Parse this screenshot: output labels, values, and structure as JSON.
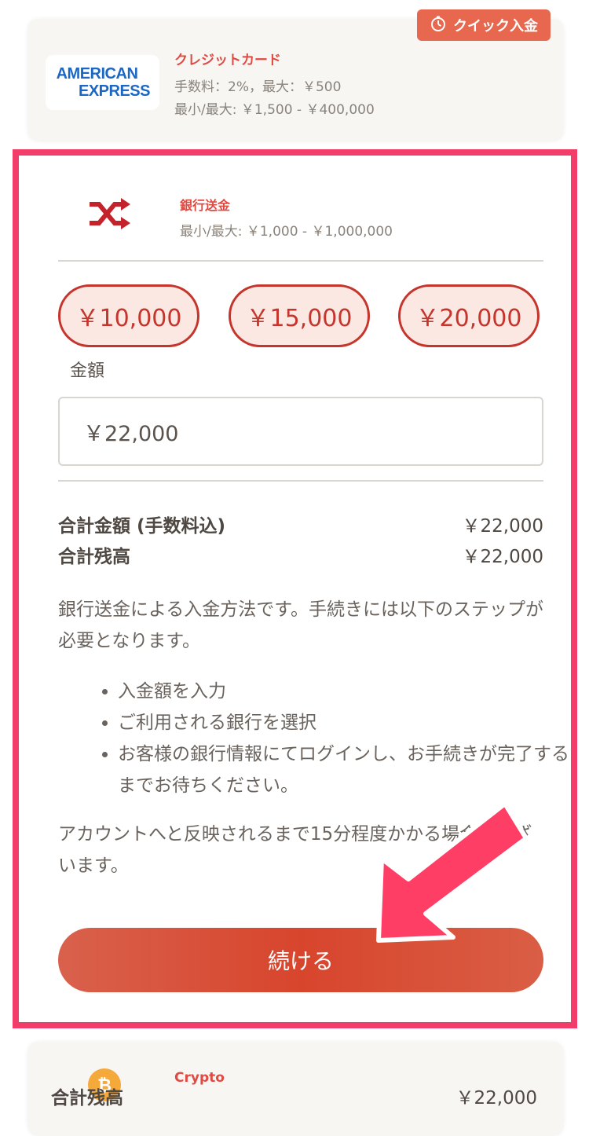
{
  "credit_card": {
    "quick_badge": "クイック入金",
    "logo_line1": "AMERICAN",
    "logo_line2": "EXPRESS",
    "title": "クレジットカード",
    "fee": "手数料：2%，最大：￥500",
    "range": "最小/最大: ￥1,500 - ￥400,000"
  },
  "bank_transfer": {
    "title": "銀行送金",
    "range": "最小/最大: ￥1,000 - ￥1,000,000",
    "presets": [
      "￥10,000",
      "￥15,000",
      "￥20,000"
    ],
    "amount_label": "金額",
    "amount_value": "￥22,000",
    "total_fee_label": "合計金額 (手数料込)",
    "total_fee_value": "￥22,000",
    "balance_label": "合計残高",
    "balance_value": "￥22,000",
    "description": "銀行送金による入金方法です。手続きには以下のステップが必要となります。",
    "steps": [
      "入金額を入力",
      "ご利用される銀行を選択",
      "お客様の銀行情報にてログインし、お手続きが完了するまでお待ちください。"
    ],
    "note": "アカウントへと反映されるまで15分程度かかる場合がございます。",
    "continue_label": "続ける"
  },
  "crypto": {
    "title": "Crypto",
    "ghost_label": "合計残高",
    "ghost_value": "￥22,000"
  },
  "colors": {
    "accent": "#e04a43",
    "highlight": "#f23d6a",
    "button": "#d8452d",
    "amex": "#1c67c4"
  }
}
